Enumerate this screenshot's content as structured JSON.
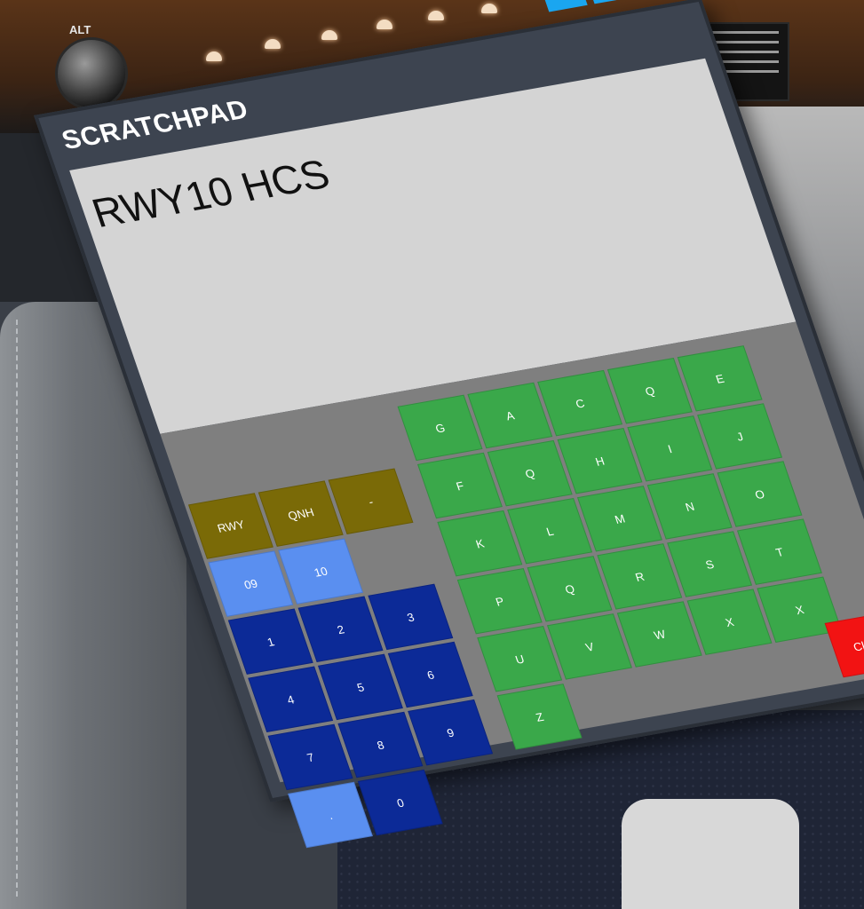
{
  "background": {
    "knob_label": "ALT"
  },
  "window": {
    "title": "SCRATCHPAD",
    "controls": {
      "minimize": "—",
      "popout": "⊘",
      "close": "✕"
    },
    "display_text": "RWY10 HCS"
  },
  "keys": {
    "rwy": "RWY",
    "qnh": "QNH",
    "dash": "-",
    "n09": "09",
    "n10": "10",
    "dot": ".",
    "n1": "1",
    "n2": "2",
    "n3": "3",
    "n4": "4",
    "n5": "5",
    "n6": "6",
    "n7": "7",
    "n8": "8",
    "n9": "9",
    "n0": "0",
    "g": "G",
    "a": "A",
    "c": "C",
    "q_top": "Q",
    "e": "E",
    "f": "F",
    "q2": "Q",
    "h": "H",
    "i": "I",
    "j": "J",
    "k": "K",
    "l": "L",
    "m": "M",
    "n": "N",
    "o": "O",
    "p": "P",
    "q": "Q",
    "r": "R",
    "s": "S",
    "t": "T",
    "u": "U",
    "v": "V",
    "w": "W",
    "x2": "X",
    "x": "X",
    "z": "Z",
    "clear": "Clear"
  },
  "colors": {
    "function_keys": "#7a6a07",
    "runway_keys": "#5a8ff0",
    "digit_keys": "#0c2a97",
    "letter_keys": "#3aa84a",
    "clear_key": "#f21313",
    "window_controls": "#1aa6f0"
  }
}
